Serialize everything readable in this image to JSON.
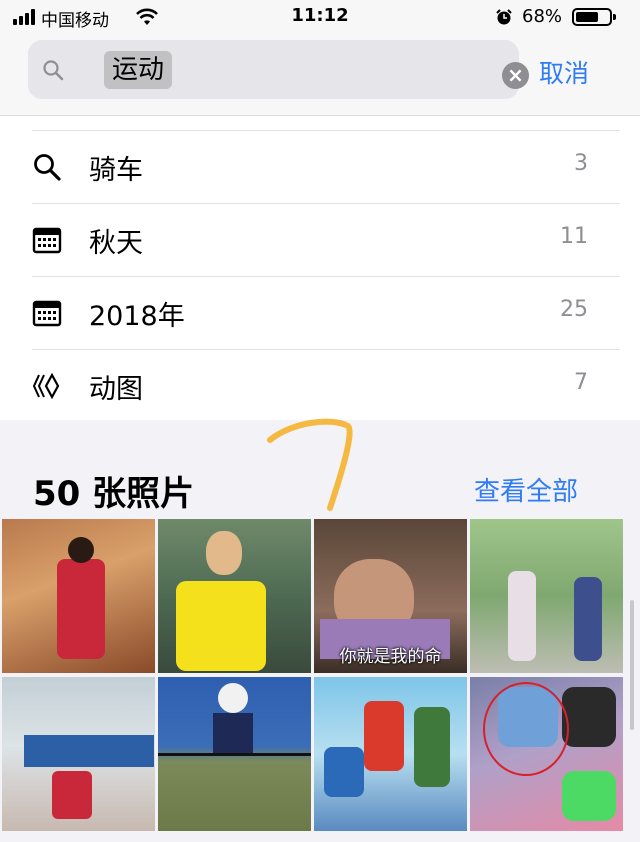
{
  "status_bar": {
    "carrier": "中国移动",
    "time": "11:12",
    "battery_percent": "68%",
    "battery_level": 0.68
  },
  "search": {
    "query_token": "运动",
    "clear_icon": "clear-circle-icon",
    "cancel_label": "取消"
  },
  "suggestions": [
    {
      "icon": "search-icon",
      "label": "骑车",
      "count": "3"
    },
    {
      "icon": "calendar-icon",
      "label": "秋天",
      "count": "11"
    },
    {
      "icon": "calendar-icon",
      "label": "2018年",
      "count": "25"
    },
    {
      "icon": "animated-icon",
      "label": "动图",
      "count": "7"
    }
  ],
  "photos": {
    "title": "50 张照片",
    "see_all_label": "查看全部",
    "items": [
      {
        "caption": ""
      },
      {
        "caption": ""
      },
      {
        "caption": "你就是我的命"
      },
      {
        "caption": ""
      },
      {
        "caption": ""
      },
      {
        "caption": ""
      },
      {
        "caption": ""
      },
      {
        "caption": ""
      }
    ]
  },
  "colors": {
    "accent": "#2f7cf6",
    "secondary_text": "#8e8e93",
    "scribble": "#f5b942"
  }
}
